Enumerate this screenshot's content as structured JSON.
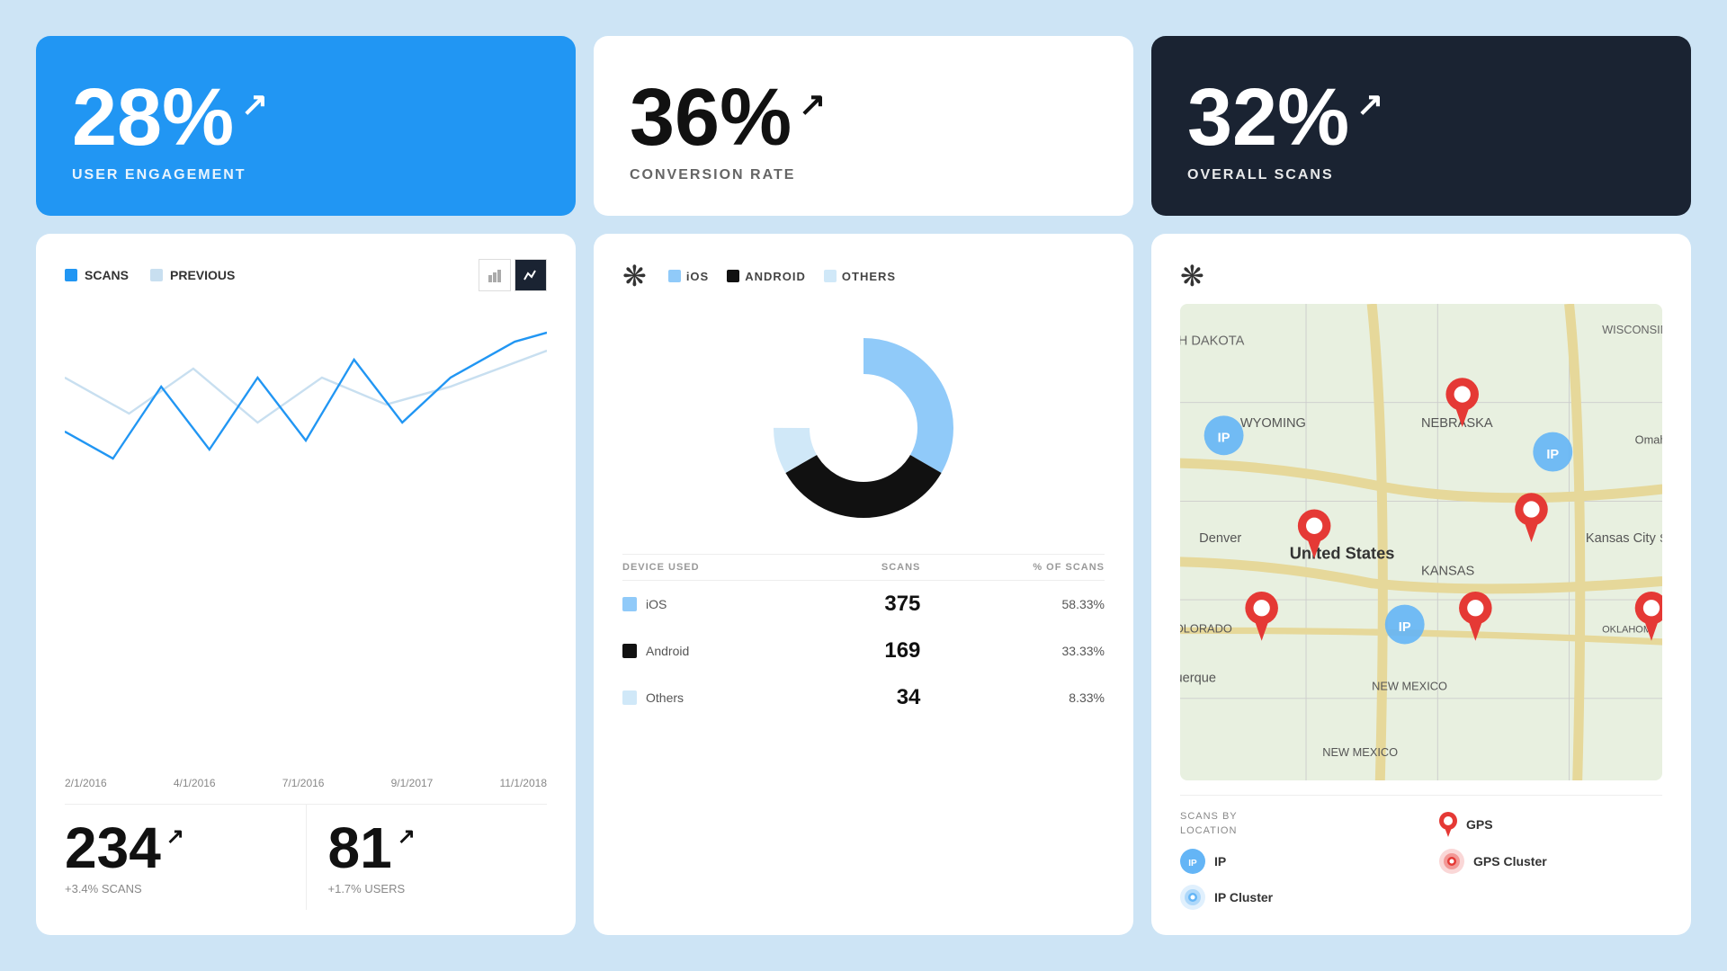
{
  "stat1": {
    "value": "28%",
    "label": "USER ENGAGEMENT",
    "theme": "blue",
    "arrow": "↗"
  },
  "stat2": {
    "value": "36%",
    "label": "CONVERSION RATE",
    "theme": "white",
    "arrow": "↗"
  },
  "stat3": {
    "value": "32%",
    "label": "OVERALL SCANS",
    "theme": "dark",
    "arrow": "↗"
  },
  "chart": {
    "legend": [
      {
        "label": "SCANS",
        "color": "#2196F3"
      },
      {
        "label": "PREVIOUS",
        "color": "#dce8f5"
      }
    ],
    "dates": [
      "2/1/2016",
      "4/1/2016",
      "7/1/2016",
      "9/1/2017",
      "11/1/2018"
    ],
    "stats": [
      {
        "value": "234",
        "arrow": "↗",
        "label": "+3.4% SCANS"
      },
      {
        "value": "81",
        "arrow": "↗",
        "label": "+1.7% USERS"
      }
    ]
  },
  "donut": {
    "legend": [
      {
        "label": "iOS",
        "color": "#90caf9"
      },
      {
        "label": "ANDROID",
        "color": "#111111"
      },
      {
        "label": "OTHERS",
        "color": "#d0e8f8"
      }
    ],
    "segments": [
      {
        "label": "iOS",
        "pct": 58.33,
        "color": "#90caf9"
      },
      {
        "label": "Android",
        "pct": 33.33,
        "color": "#111111"
      },
      {
        "label": "Others",
        "pct": 8.34,
        "color": "#d0e8f8"
      }
    ],
    "table": {
      "headers": [
        "DEVICE USED",
        "SCANS",
        "% OF SCANS"
      ],
      "rows": [
        {
          "device": "iOS",
          "colorBox": "#90caf9",
          "scans": "375",
          "pct": "58.33%"
        },
        {
          "device": "Android",
          "colorBox": "#111111",
          "scans": "169",
          "pct": "33.33%"
        },
        {
          "device": "Others",
          "colorBox": "#d0e8f8",
          "scans": "34",
          "pct": "8.33%"
        }
      ]
    }
  },
  "map": {
    "legend_label": "SCANS BY\nLOCATION",
    "items": [
      {
        "type": "gps",
        "label": "GPS"
      },
      {
        "type": "ip",
        "label": "IP"
      },
      {
        "type": "gps-cluster",
        "label": "GPS Cluster"
      },
      {
        "type": "ip-cluster",
        "label": "IP Cluster"
      }
    ]
  }
}
